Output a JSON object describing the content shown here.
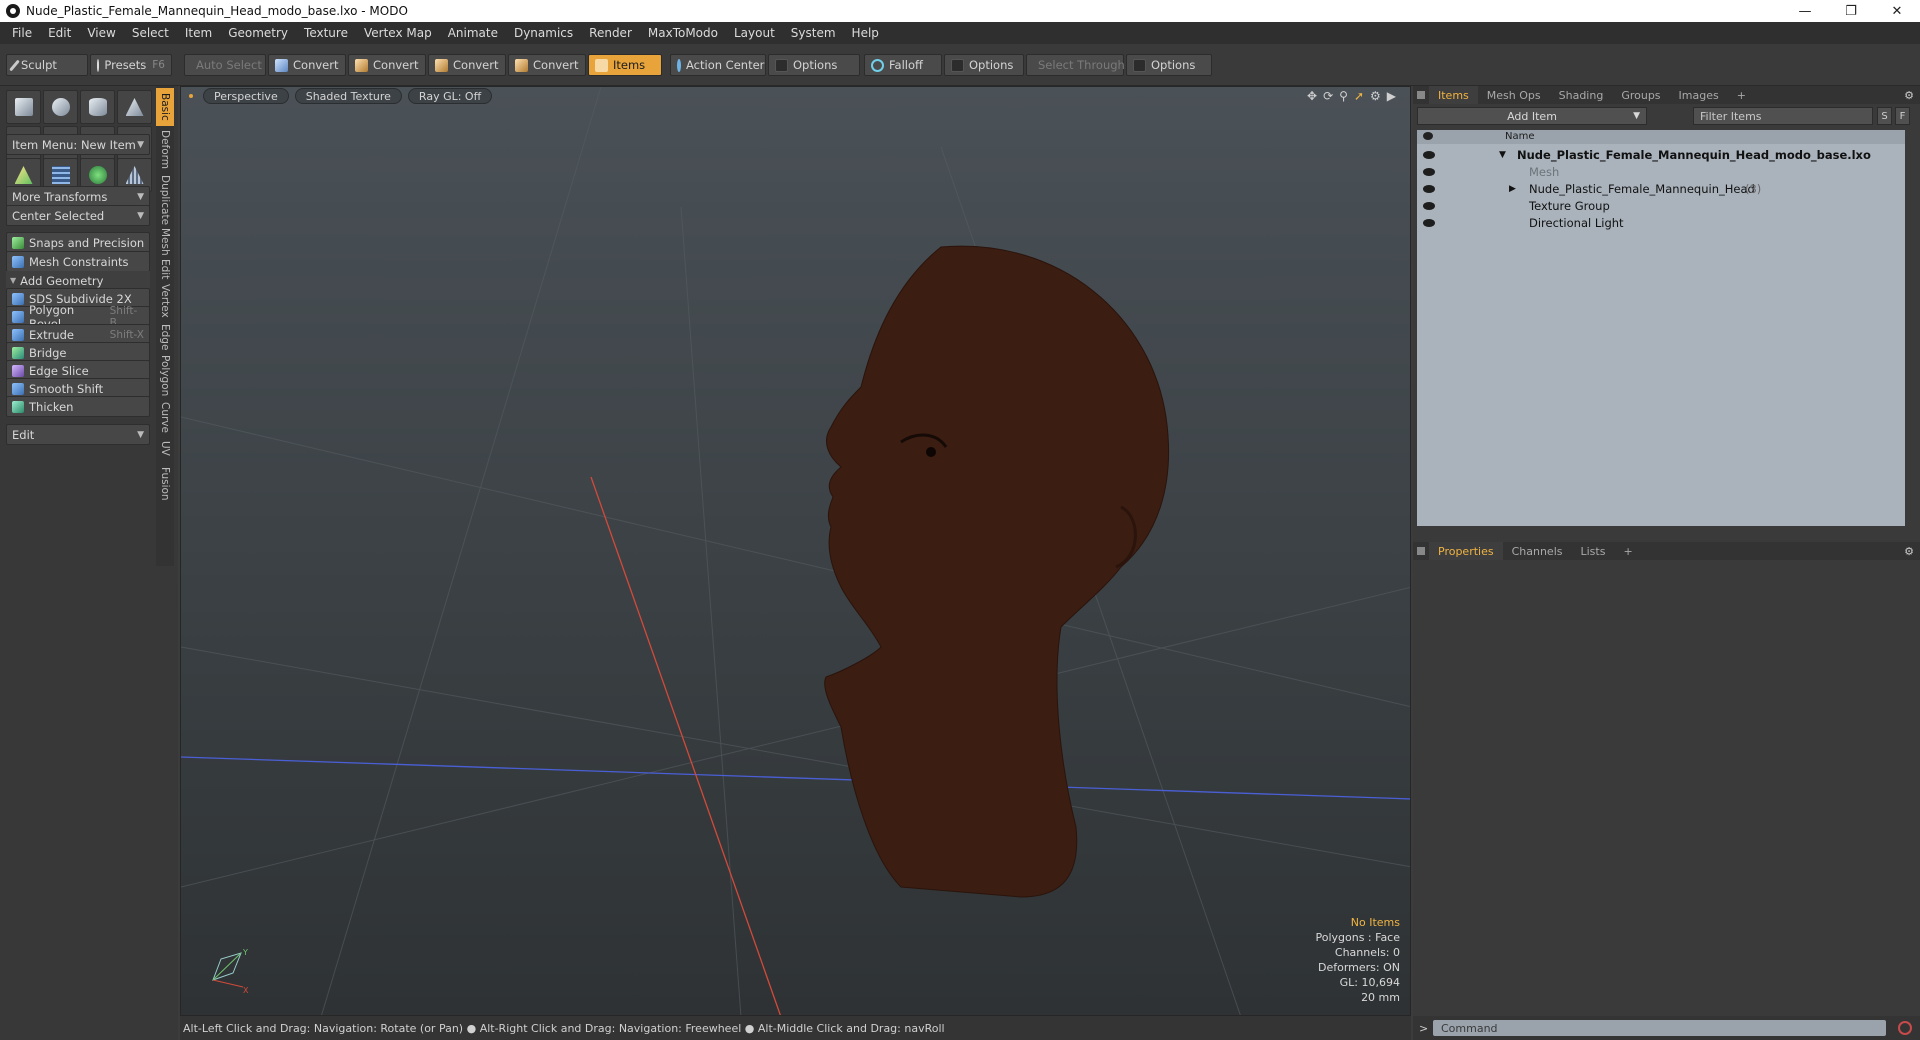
{
  "window": {
    "title": "Nude_Plastic_Female_Mannequin_Head_modo_base.lxo - MODO"
  },
  "menu": [
    "File",
    "Edit",
    "View",
    "Select",
    "Item",
    "Geometry",
    "Texture",
    "Vertex Map",
    "Animate",
    "Dynamics",
    "Render",
    "MaxToModo",
    "Layout",
    "System",
    "Help"
  ],
  "toolbar": {
    "sculpt": "Sculpt",
    "presets": "Presets",
    "presets_hotkey": "F6",
    "auto_select": "Auto Select",
    "convert1": "Convert",
    "convert2": "Convert",
    "convert3": "Convert",
    "convert4": "Convert",
    "items": "Items",
    "action_center": "Action Center",
    "options1": "Options",
    "falloff": "Falloff",
    "options2": "Options",
    "select_through": "Select Through",
    "options3": "Options"
  },
  "left": {
    "item_menu": "Item Menu: New Item",
    "more_transforms": "More Transforms",
    "center_selected": "Center Selected",
    "snaps": "Snaps and Precision",
    "mesh_constraints": "Mesh Constraints",
    "add_geometry": "Add Geometry",
    "tools": [
      {
        "label": "SDS Subdivide 2X",
        "hotkey": ""
      },
      {
        "label": "Polygon Bevel",
        "hotkey": "Shift-B"
      },
      {
        "label": "Extrude",
        "hotkey": "Shift-X"
      },
      {
        "label": "Bridge",
        "hotkey": ""
      },
      {
        "label": "Edge Slice",
        "hotkey": ""
      },
      {
        "label": "Smooth Shift",
        "hotkey": ""
      },
      {
        "label": "Thicken",
        "hotkey": ""
      }
    ],
    "edit": "Edit"
  },
  "vtabs": [
    "Basic",
    "Deform",
    "Duplicate",
    "Mesh Edit",
    "Vertex",
    "Edge",
    "Polygon",
    "Curve",
    "UV",
    "Fusion"
  ],
  "viewport": {
    "perspective": "Perspective",
    "shading": "Shaded Texture",
    "raygl": "Ray GL: Off",
    "stats": {
      "no_items": "No Items",
      "polygons": "Polygons : Face",
      "channels": "Channels: 0",
      "deformers": "Deformers: ON",
      "gl": "GL: 10,694",
      "scale": "20 mm"
    }
  },
  "status": "Alt-Left Click and Drag: Navigation: Rotate (or Pan) ● Alt-Right Click and Drag: Navigation: Freewheel ● Alt-Middle Click and Drag: navRoll",
  "right": {
    "tabs": [
      "Items",
      "Mesh Ops",
      "Shading",
      "Groups",
      "Images"
    ],
    "add_item": "Add Item",
    "filter": "Filter Items",
    "s_btn": "S",
    "f_btn": "F",
    "col_name": "Name",
    "tree": [
      {
        "label": "Nude_Plastic_Female_Mannequin_Head_modo_base.lxo",
        "count": ""
      },
      {
        "label": "Mesh",
        "count": ""
      },
      {
        "label": "Nude_Plastic_Female_Mannequin_Head",
        "count": "(3)"
      },
      {
        "label": "Texture Group",
        "count": ""
      },
      {
        "label": "Directional Light",
        "count": ""
      }
    ],
    "bottom_tabs": [
      "Properties",
      "Channels",
      "Lists"
    ],
    "command_placeholder": "Command"
  },
  "colors": {
    "accent": "#e8a33a",
    "tab_active": "#f0b442",
    "head_skin": "#3b1d12"
  }
}
